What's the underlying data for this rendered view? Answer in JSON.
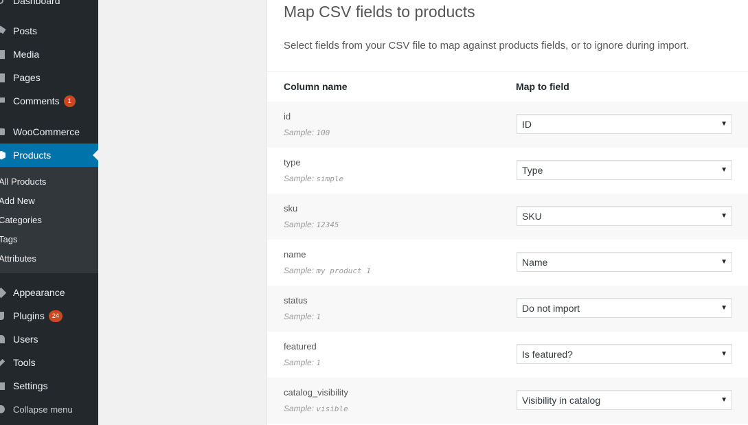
{
  "sidebar": {
    "dashboard": "Dashboard",
    "posts": "Posts",
    "media": "Media",
    "pages": "Pages",
    "comments": "Comments",
    "comments_count": "1",
    "woocommerce": "WooCommerce",
    "products": "Products",
    "sub": {
      "all_products": "All Products",
      "add_new": "Add New",
      "categories": "Categories",
      "tags": "Tags",
      "attributes": "Attributes"
    },
    "appearance": "Appearance",
    "plugins": "Plugins",
    "plugins_count": "24",
    "users": "Users",
    "tools": "Tools",
    "settings": "Settings",
    "collapse": "Collapse menu",
    "active_color": "#0073aa",
    "badge_color": "#ca4a1f"
  },
  "mapper": {
    "title": "Map CSV fields to products",
    "description": "Select fields from your CSV file to map against products fields, or to ignore during import.",
    "col_header": "Column name",
    "map_header": "Map to field",
    "sample_prefix": "Sample:",
    "rows": [
      {
        "name": "id",
        "sample": "100",
        "field": "ID"
      },
      {
        "name": "type",
        "sample": "simple",
        "field": "Type"
      },
      {
        "name": "sku",
        "sample": "12345",
        "field": "SKU"
      },
      {
        "name": "name",
        "sample": "my product 1",
        "field": "Name"
      },
      {
        "name": "status",
        "sample": "1",
        "field": "Do not import"
      },
      {
        "name": "featured",
        "sample": "1",
        "field": "Is featured?"
      },
      {
        "name": "catalog_visibility",
        "sample": "visible",
        "field": "Visibility in catalog"
      }
    ]
  }
}
